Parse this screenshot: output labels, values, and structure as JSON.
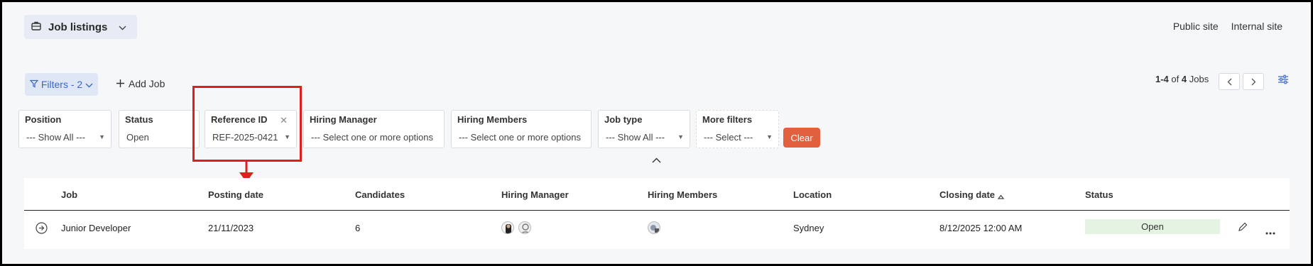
{
  "header": {
    "switcher_label": "Job listings",
    "links": [
      "Public site",
      "Internal site"
    ]
  },
  "toolbar": {
    "filters_label": "Filters - 2",
    "add_job_label": "Add Job",
    "pager": {
      "range": "1-4",
      "of": "of",
      "total": "4",
      "unit": "Jobs"
    }
  },
  "filters": {
    "position": {
      "label": "Position",
      "value": "--- Show All ---"
    },
    "status": {
      "label": "Status",
      "value": "Open"
    },
    "reference_id": {
      "label": "Reference ID",
      "value": "REF-2025-0421"
    },
    "hiring_manager": {
      "label": "Hiring Manager",
      "value": "--- Select one or more options"
    },
    "hiring_members": {
      "label": "Hiring Members",
      "value": "--- Select one or more options"
    },
    "job_type": {
      "label": "Job type",
      "value": "--- Show All ---"
    },
    "more_filters": {
      "label": "More filters",
      "value": "--- Select ---"
    },
    "clear_label": "Clear"
  },
  "table": {
    "columns": [
      "Job",
      "Posting date",
      "Candidates",
      "Hiring Manager",
      "Hiring Members",
      "Location",
      "Closing date",
      "Status"
    ],
    "rows": [
      {
        "job": "Junior Developer",
        "posting_date": "21/11/2023",
        "candidates": "6",
        "location": "Sydney",
        "closing_date": "8/12/2025 12:00 AM",
        "status": "Open"
      }
    ]
  },
  "colors": {
    "accent": "#3a67c8",
    "clear_button": "#e3603f",
    "highlight": "#e01e1e",
    "status_open_bg": "#e5f3e2"
  }
}
